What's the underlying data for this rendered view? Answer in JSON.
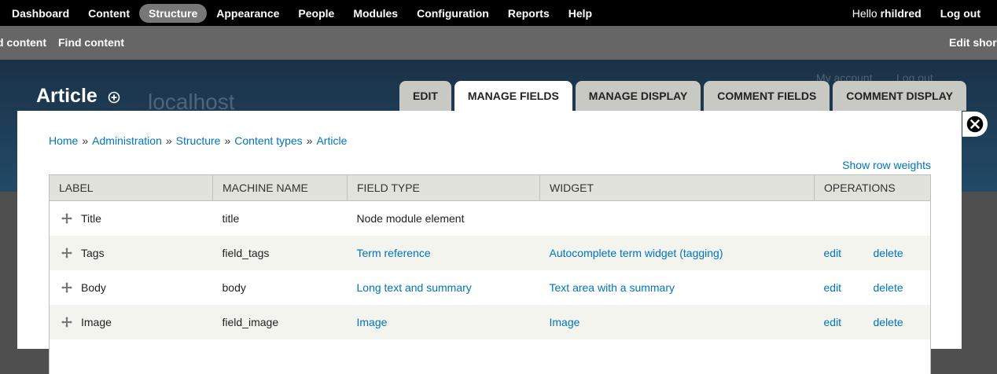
{
  "toolbar": {
    "menu": [
      "Dashboard",
      "Content",
      "Structure",
      "Appearance",
      "People",
      "Modules",
      "Configuration",
      "Reports",
      "Help"
    ],
    "active": "Structure",
    "hello_prefix": "Hello ",
    "username": "rhildred",
    "logout": "Log out"
  },
  "shortcuts": {
    "items": [
      "d content",
      "Find content"
    ],
    "edit": "Edit short"
  },
  "header": {
    "site_name": "localhost",
    "my_account": "My account",
    "log_out": "Log out",
    "title": "Article",
    "tabs": [
      "EDIT",
      "MANAGE FIELDS",
      "MANAGE DISPLAY",
      "COMMENT FIELDS",
      "COMMENT DISPLAY"
    ],
    "active_tab": "MANAGE FIELDS"
  },
  "breadcrumb": [
    "Home",
    "Administration",
    "Structure",
    "Content types",
    "Article"
  ],
  "breadcrumb_separator": "»",
  "row_weights_label": "Show row weights",
  "table": {
    "headers": [
      "LABEL",
      "MACHINE NAME",
      "FIELD TYPE",
      "WIDGET",
      "OPERATIONS"
    ],
    "rows": [
      {
        "label": "Title",
        "machine": "title",
        "type": "Node module element",
        "type_link": false,
        "widget": "",
        "edit": "",
        "delete": ""
      },
      {
        "label": "Tags",
        "machine": "field_tags",
        "type": "Term reference",
        "type_link": true,
        "widget": "Autocomplete term widget (tagging)",
        "edit": "edit",
        "delete": "delete"
      },
      {
        "label": "Body",
        "machine": "body",
        "type": "Long text and summary",
        "type_link": true,
        "widget": "Text area with a summary",
        "edit": "edit",
        "delete": "delete"
      },
      {
        "label": "Image",
        "machine": "field_image",
        "type": "Image",
        "type_link": true,
        "widget": "Image",
        "edit": "edit",
        "delete": "delete"
      }
    ]
  },
  "colors": {
    "link": "#0074bd",
    "toolbar": "#000000",
    "shortcuts": "#666666",
    "header": "#224a68"
  },
  "icons": {
    "add_shortcut": "plus-circle-icon",
    "close": "close-icon",
    "drag": "drag-handle-icon"
  }
}
